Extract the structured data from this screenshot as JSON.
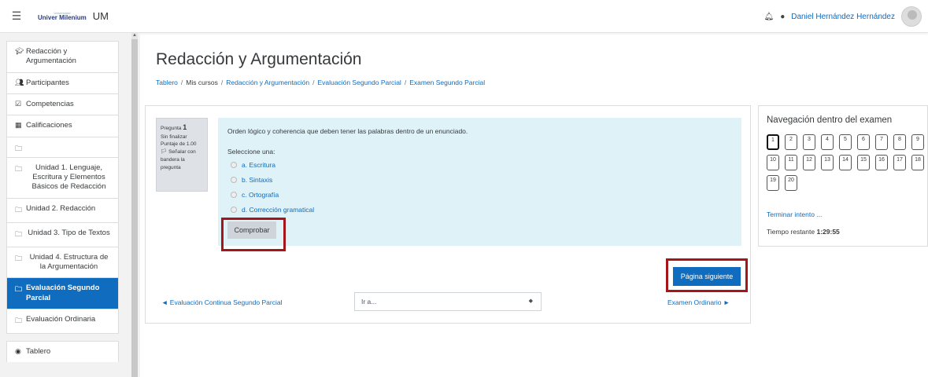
{
  "header": {
    "logo_small": "Universidad",
    "logo_main": "Univer Milenium",
    "site_name": "UM",
    "user_name": "Daniel Hernández Hernández"
  },
  "sidebar": {
    "items": [
      {
        "label": "Redacción y Argumentación",
        "icon": "graduation-cap-icon"
      },
      {
        "label": "Participantes",
        "icon": "users-icon"
      },
      {
        "label": "Competencias",
        "icon": "checkbox-icon"
      },
      {
        "label": "Calificaciones",
        "icon": "table-icon"
      },
      {
        "label": "",
        "icon": "folder-icon"
      },
      {
        "label": "Unidad 1. Lenguaje, Escritura y Elementos Básicos de Redacción",
        "icon": "folder-icon"
      },
      {
        "label": "Unidad 2. Redacción",
        "icon": "folder-icon"
      },
      {
        "label": "Unidad 3. Tipo de Textos",
        "icon": "folder-icon"
      },
      {
        "label": "Unidad 4. Estructura de la Argumentación",
        "icon": "folder-icon"
      },
      {
        "label": "Evaluación Segundo Parcial",
        "icon": "folder-icon"
      },
      {
        "label": "Evaluación Ordinaria",
        "icon": "folder-icon"
      },
      {
        "label": "Tablero",
        "icon": "dashboard-icon"
      }
    ]
  },
  "page": {
    "title": "Redacción y Argumentación",
    "breadcrumb": [
      "Tablero",
      "Mis cursos",
      "Redacción y Argumentación",
      "Evaluación Segundo Parcial",
      "Examen Segundo Parcial"
    ]
  },
  "question": {
    "label": "Pregunta",
    "number": "1",
    "status": "Sin finalizar",
    "score": "Puntaje de 1.00",
    "flag": "Señalar con bandera la pregunta",
    "text": "Orden lógico y coherencia que deben tener las palabras dentro de un enunciado.",
    "prompt": "Seleccione una:",
    "answers": [
      "a. Escritura",
      "b. Sintaxis",
      "c. Ortografía",
      "d. Corrección gramatical"
    ],
    "check_button": "Comprobar"
  },
  "navigation": {
    "next_page_button": "Página siguiente",
    "prev_link": "◄ Evaluación Continua Segundo Parcial",
    "jump_select": "Ir a...",
    "next_link": "Examen Ordinario ►"
  },
  "quiz_nav": {
    "title": "Navegación dentro del examen",
    "questions": [
      "1",
      "2",
      "3",
      "4",
      "5",
      "6",
      "7",
      "8",
      "9",
      "10",
      "11",
      "12",
      "13",
      "14",
      "15",
      "16",
      "17",
      "18",
      "19",
      "20"
    ],
    "finish_link": "Terminar intento ...",
    "time_label": "Tiempo restante",
    "time_value": "1:29:55"
  },
  "colors": {
    "accent": "#0f6cbf",
    "highlight_box": "#a4161a",
    "question_bg": "#def2f8"
  }
}
